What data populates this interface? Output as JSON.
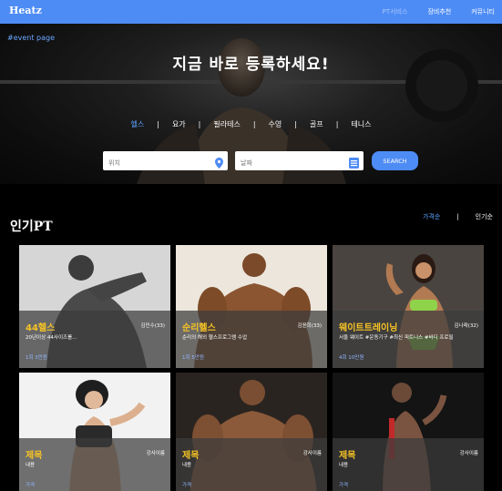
{
  "nav": {
    "brand": "Heatz",
    "links": [
      "PT서비스",
      "장비추천",
      "커뮤니티"
    ]
  },
  "hero": {
    "event_tag": "#event page",
    "title": "지금 바로 등록하세요!",
    "categories": [
      "헬스",
      "요가",
      "필라테스",
      "수영",
      "골프",
      "테니스"
    ],
    "active_category": "헬스",
    "search": {
      "location_placeholder": "위치",
      "date_placeholder": "날짜",
      "button_label": "SEARCH"
    }
  },
  "section": {
    "title": "인기PT",
    "sort_options": [
      "가격순",
      "인기순"
    ],
    "active_sort": "가격순"
  },
  "cards": [
    {
      "title": "44헬스",
      "trainer": "김민수(33)",
      "desc": "20년이상 44사이즈를...",
      "price": "1회 3만원"
    },
    {
      "title": "순리헬스",
      "trainer": "김윤희(33)",
      "desc": "순리의 해외 헬스프로그램 수업",
      "price": "1회 5만원"
    },
    {
      "title": "웨이트트레이닝",
      "trainer": "김나래(32)",
      "desc": "서울 웨이트 #운동기구 #최신 피트니스 #바디 프로필",
      "price": "4회 10만원"
    },
    {
      "title": "제목",
      "trainer": "강사이름",
      "desc": "내용",
      "price": "가격"
    },
    {
      "title": "제목",
      "trainer": "강사이름",
      "desc": "내용",
      "price": "가격"
    },
    {
      "title": "제목",
      "trainer": "강사이름",
      "desc": "내용",
      "price": "가격"
    }
  ],
  "colors": {
    "primary": "#4e8cf5",
    "accent_title": "#f6c324",
    "active_link": "#5ba3ff",
    "background": "#000000"
  }
}
